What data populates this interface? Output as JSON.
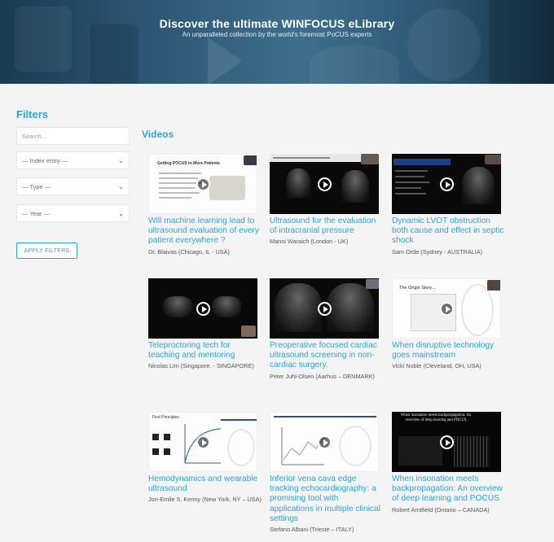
{
  "hero": {
    "title": "Discover the ultimate WINFOCUS eLibrary",
    "subtitle": "An unparalleled collection by the world's foremost PoCUS experts"
  },
  "filters": {
    "title": "Filters",
    "search_placeholder": "Search...",
    "index_entry": "— Index entry —",
    "type": "— Type —",
    "year": "— Year —",
    "apply_label": "APPLY FILTERS"
  },
  "videos": {
    "title": "Videos",
    "items": [
      {
        "title": "Will machine learning lead to ultrasound evaluation of every patient everywhere ?",
        "author": "Dr. Blaivas (Chicago, IL - USA)"
      },
      {
        "title": "Ultrasound for the evaluation of intracranial pressure",
        "author": "Manni Waraich (London - UK)"
      },
      {
        "title": "Dynamic LVOT obstruction both cause and effect in septic shock",
        "author": "Sam Orde (Sydney - AUSTRALIA)"
      },
      {
        "title": "Teleproctoring tech for teaching and mentoring",
        "author": "Nicolas Lim (Singapore. - SINGAPORE)"
      },
      {
        "title": "Preoperative focused cardiac ultrasound screening in non-cardiac surgery.",
        "author": "Peter Juhl-Olsen (Aarhus – DENMARK)"
      },
      {
        "title": "When disruptive technology goes mainstream",
        "author": "Vicki Noble (Cleveland, OH, USA)"
      },
      {
        "title": "Hemodynamics and wearable ultrasound",
        "author": "Jon-Emile S. Kenny (New York, NY – USA)"
      },
      {
        "title": "Inferior vena cava edge tracking echocardiography: a promising tool with applications in multiple clinical settings",
        "author": "Stefano Albani (Trieste – ITALY)"
      },
      {
        "title": "When insonation meets backpropagation: An overview of deep learning and POCUS",
        "author": "Robert Arntfield (Ontario – CANADA)"
      }
    ]
  },
  "thumbs": {
    "t1_heading": "Getting POCUS to More Patients",
    "t6_heading": "The Origin Story...",
    "t7_heading": "First Principles",
    "t9_heading": "When insonation meets backpropagation: An overview of deep learning and POCUS"
  },
  "colors": {
    "accent": "#2aa4d9",
    "hero_dark": "#1c3b52",
    "page_bg": "#f4f4f4"
  }
}
